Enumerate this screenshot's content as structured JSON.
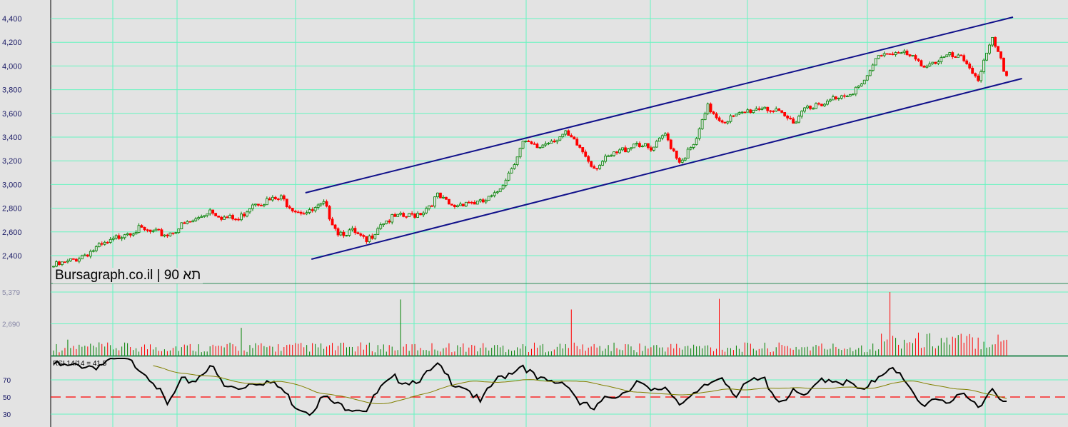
{
  "chart_data": {
    "type": "candlestick",
    "title": "Bursagraph.co.il | 90 תא",
    "price_axis": {
      "ticks": [
        "4,400",
        "4,200",
        "4,000",
        "3,800",
        "3,600",
        "3,400",
        "3,200",
        "3,000",
        "2,800",
        "2,600",
        "2,400"
      ],
      "tick_values": [
        4400,
        4200,
        4000,
        3800,
        3600,
        3400,
        3200,
        3000,
        2800,
        2600,
        2400
      ],
      "ylim": [
        2320,
        4590
      ]
    },
    "closes": [
      2310,
      2340,
      2400,
      2460,
      2510,
      2600,
      2620,
      2590,
      2580,
      2650,
      2700,
      2790,
      2720,
      2700,
      2850,
      2860,
      2880,
      2790,
      2760,
      2830,
      2600,
      2600,
      2510,
      2680,
      2720,
      2730,
      2780,
      2900,
      2810,
      2860,
      2840,
      2900,
      3100,
      3350,
      3310,
      3380,
      3420,
      3310,
      3150,
      3220,
      3290,
      3360,
      3280,
      3420,
      3200,
      3320,
      3650,
      3540,
      3570,
      3630,
      3660,
      3590,
      3530,
      3680,
      3650,
      3740,
      3780,
      3850,
      4100,
      4120,
      4090,
      4010,
      4040,
      4080,
      4050,
      3900,
      4210,
      3920
    ],
    "candles_per_segment": 5,
    "trendlines": [
      {
        "name": "upper-channel",
        "start": [
          84,
          2930
        ],
        "end": [
          320,
          4412
        ],
        "color": "#10108a"
      },
      {
        "name": "lower-channel",
        "start": [
          86,
          2370
        ],
        "end": [
          323,
          3894
        ],
        "color": "#10108a"
      }
    ],
    "volume": {
      "ticks": [
        "5,379",
        "2,690"
      ],
      "tick_values": [
        5379,
        2690
      ],
      "base": 700,
      "spikes": [
        {
          "index": 5,
          "value": 1350
        },
        {
          "index": 66,
          "value": 2350
        },
        {
          "index": 122,
          "value": 4750
        },
        {
          "index": 182,
          "value": 3900
        },
        {
          "index": 234,
          "value": 4800
        },
        {
          "index": 294,
          "value": 5379
        }
      ]
    },
    "rsi": {
      "label": "RSI 14/14 = 41.5",
      "ticks": [
        "70",
        "50",
        "30"
      ],
      "tick_values": [
        70,
        50,
        30
      ],
      "values": [
        88,
        85,
        87,
        86,
        92,
        94,
        85,
        70,
        40,
        68,
        70,
        88,
        62,
        60,
        68,
        68,
        60,
        40,
        33,
        50,
        40,
        38,
        36,
        60,
        72,
        68,
        73,
        86,
        68,
        62,
        43,
        68,
        78,
        88,
        70,
        67,
        68,
        43,
        35,
        50,
        55,
        68,
        55,
        62,
        45,
        50,
        64,
        75,
        52,
        68,
        70,
        45,
        55,
        50,
        72,
        70,
        65,
        55,
        75,
        88,
        62,
        40,
        50,
        45,
        50,
        40,
        60,
        45
      ]
    },
    "colors": {
      "up": "#008000",
      "down": "#ff0000",
      "grid": "#66f5c0",
      "rsi": "#000000",
      "rsi_ma": "#808000",
      "midline": "#ff0000"
    }
  }
}
